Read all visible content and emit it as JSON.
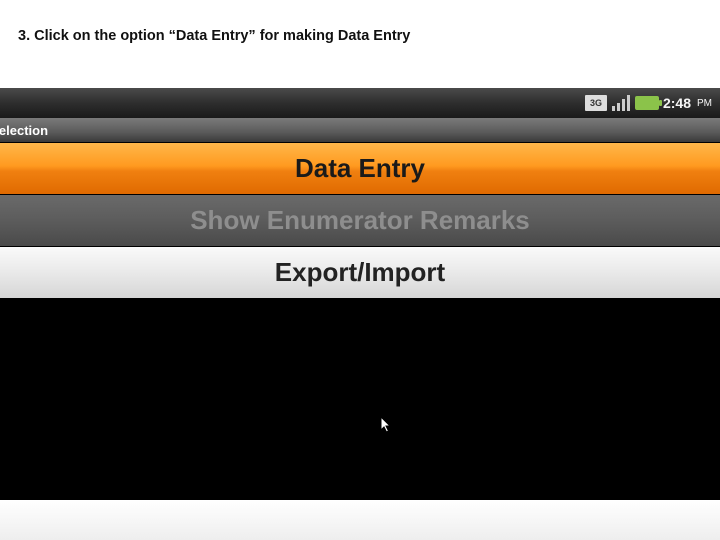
{
  "instruction": "3. Click on the option “Data Entry” for making Data Entry",
  "status": {
    "net_label": "3G",
    "time": "2:48",
    "ampm": "PM"
  },
  "title_bar": "ter Selection",
  "options": {
    "data_entry": "Data Entry",
    "show_remarks": "Show Enumerator Remarks",
    "export_import": "Export/Import"
  }
}
